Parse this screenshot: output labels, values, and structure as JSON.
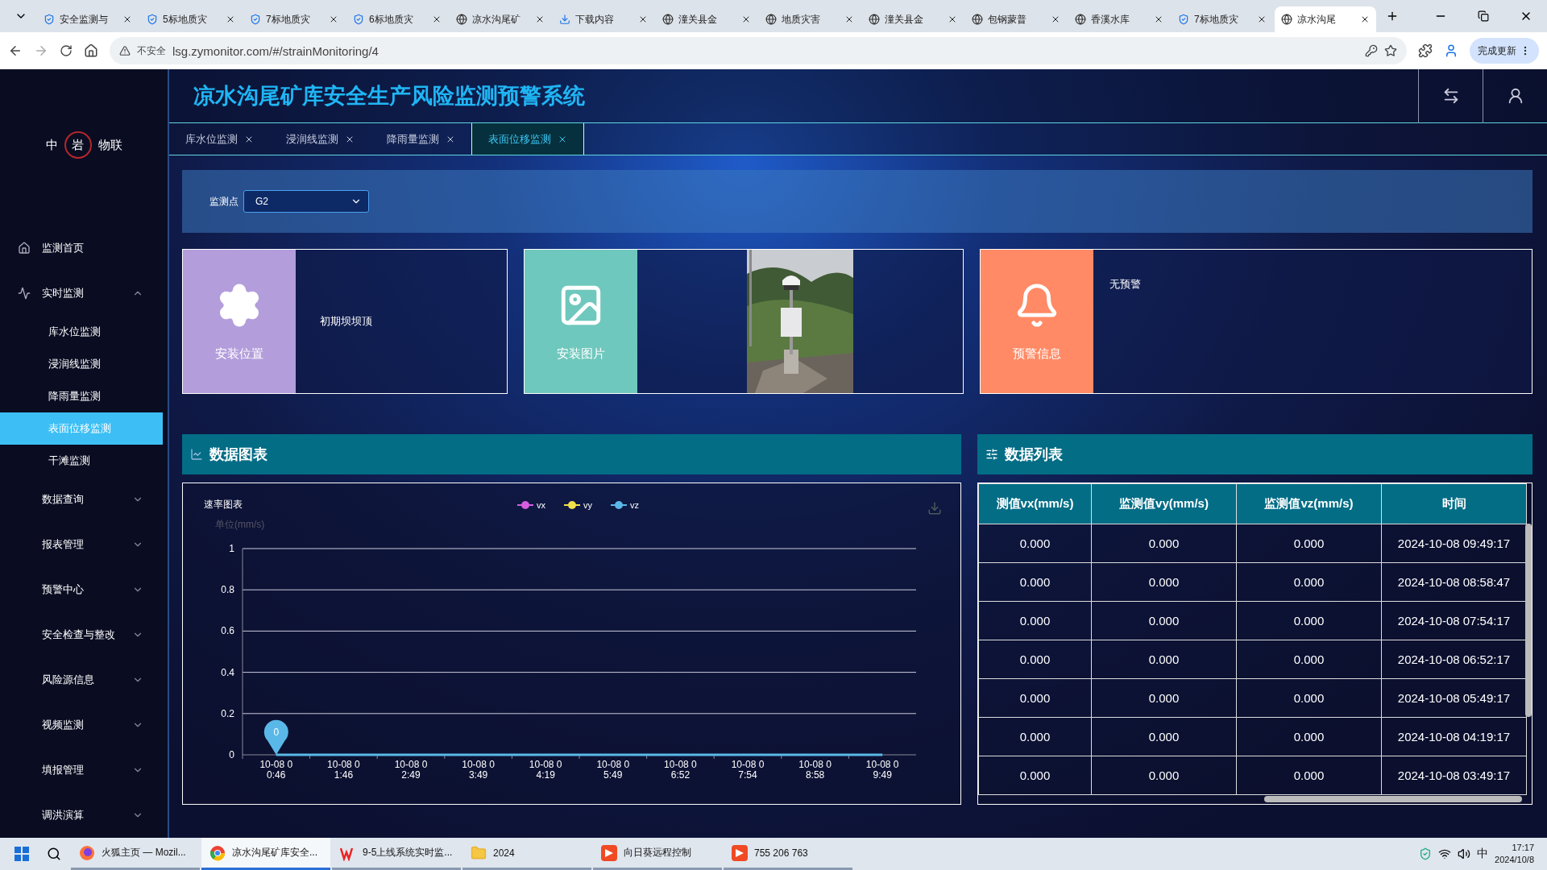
{
  "browser": {
    "tabs": [
      {
        "label": "安全监测与",
        "kind": "app",
        "selected": false
      },
      {
        "label": "5标地质灾",
        "kind": "app",
        "selected": false
      },
      {
        "label": "7标地质灾",
        "kind": "app",
        "selected": false
      },
      {
        "label": "6标地质灾",
        "kind": "app",
        "selected": false
      },
      {
        "label": "凉水沟尾矿",
        "kind": "globe",
        "selected": false
      },
      {
        "label": "下载内容",
        "kind": "download",
        "selected": false
      },
      {
        "label": "潼关县金",
        "kind": "globe",
        "selected": false
      },
      {
        "label": "地质灾害",
        "kind": "globe",
        "selected": false
      },
      {
        "label": "潼关县金",
        "kind": "globe",
        "selected": false
      },
      {
        "label": "包钢蒙普",
        "kind": "globe",
        "selected": false
      },
      {
        "label": "香溪水库",
        "kind": "globe",
        "selected": false
      },
      {
        "label": "7标地质灾",
        "kind": "app",
        "selected": false
      },
      {
        "label": "凉水沟尾",
        "kind": "globe",
        "selected": true
      }
    ],
    "security": "不安全",
    "url": "lsg.zymonitor.com/#/strainMonitoring/4",
    "update_button": "完成更新"
  },
  "app": {
    "logo": {
      "left": "中",
      "center": "岩",
      "right": "物联"
    },
    "title": "凉水沟尾矿库安全生产风险监测预警系统",
    "nav": [
      {
        "label": "监测首页",
        "kind": "link",
        "selected": false
      },
      {
        "label": "实时监测",
        "kind": "group",
        "expanded": true,
        "selected": false,
        "children": [
          {
            "label": "库水位监测",
            "selected": false
          },
          {
            "label": "浸润线监测",
            "selected": false
          },
          {
            "label": "降雨量监测",
            "selected": false
          },
          {
            "label": "表面位移监测",
            "selected": true
          },
          {
            "label": "干滩监测",
            "selected": false
          }
        ]
      },
      {
        "label": "数据查询",
        "kind": "group",
        "expanded": false,
        "selected": false
      },
      {
        "label": "报表管理",
        "kind": "group",
        "expanded": false,
        "selected": false
      },
      {
        "label": "预警中心",
        "kind": "group",
        "expanded": false,
        "selected": false
      },
      {
        "label": "安全检查与整改",
        "kind": "group",
        "expanded": false,
        "selected": false
      },
      {
        "label": "风险源信息",
        "kind": "group",
        "expanded": false,
        "selected": false
      },
      {
        "label": "视频监测",
        "kind": "group",
        "expanded": false,
        "selected": false
      },
      {
        "label": "填报管理",
        "kind": "group",
        "expanded": false,
        "selected": false
      },
      {
        "label": "调洪演算",
        "kind": "group",
        "expanded": false,
        "selected": false
      }
    ],
    "tabs": [
      {
        "label": "库水位监测",
        "selected": false
      },
      {
        "label": "浸润线监测",
        "selected": false
      },
      {
        "label": "降雨量监测",
        "selected": false
      },
      {
        "label": "表面位移监测",
        "selected": true
      }
    ],
    "filter": {
      "label": "监测点",
      "value": "G2"
    },
    "cards": [
      {
        "kind": "location",
        "label": "安装位置",
        "text": "初期坝坝顶",
        "color": "#b39ddb"
      },
      {
        "label": "安装图片",
        "color": "#6fc8bd"
      },
      {
        "kind": "alert",
        "label": "预警信息",
        "text": "无预警",
        "color": "#ff8a65"
      }
    ],
    "chart_panel": {
      "title": "数据图表",
      "chart_data": {
        "type": "line",
        "title": "速率图表",
        "ylabel": "单位(mm/s)",
        "categories": [
          "10-08 00:46",
          "10-08 01:46",
          "10-08 02:49",
          "10-08 03:49",
          "10-08 04:19",
          "10-08 05:49",
          "10-08 06:52",
          "10-08 07:54",
          "10-08 08:58",
          "10-08 09:49"
        ],
        "series": [
          {
            "name": "vx",
            "color": "#d65ce0",
            "values": [
              null,
              null,
              null,
              null,
              null,
              null,
              null,
              null,
              null,
              null
            ]
          },
          {
            "name": "vy",
            "color": "#f0e04a",
            "values": [
              null,
              null,
              null,
              null,
              null,
              null,
              null,
              null,
              null,
              null
            ]
          },
          {
            "name": "vz",
            "color": "#5ab8e8",
            "values": [
              0,
              0,
              0,
              0,
              0,
              0,
              0,
              0,
              0,
              0
            ]
          }
        ],
        "ylim": [
          0,
          1
        ],
        "yticks": [
          0,
          0.2,
          0.4,
          0.6,
          0.8,
          1
        ],
        "grid": true,
        "legend": "top",
        "annotations": [
          {
            "x": "10-08 00:46",
            "y": 0,
            "text": "0"
          }
        ]
      }
    },
    "table_panel": {
      "title": "数据列表",
      "columns": [
        "测值vx(mm/s)",
        "监测值vy(mm/s)",
        "监测值vz(mm/s)",
        "时间"
      ],
      "rows": [
        [
          "0.000",
          "0.000",
          "0.000",
          "2024-10-08 09:49:17"
        ],
        [
          "0.000",
          "0.000",
          "0.000",
          "2024-10-08 08:58:47"
        ],
        [
          "0.000",
          "0.000",
          "0.000",
          "2024-10-08 07:54:17"
        ],
        [
          "0.000",
          "0.000",
          "0.000",
          "2024-10-08 06:52:17"
        ],
        [
          "0.000",
          "0.000",
          "0.000",
          "2024-10-08 05:49:17"
        ],
        [
          "0.000",
          "0.000",
          "0.000",
          "2024-10-08 04:19:17"
        ],
        [
          "0.000",
          "0.000",
          "0.000",
          "2024-10-08 03:49:17"
        ]
      ]
    }
  },
  "taskbar": {
    "apps": [
      {
        "label": "火狐主页 — Mozil...",
        "kind": "firefox",
        "selected": false
      },
      {
        "label": "凉水沟尾矿库安全...",
        "kind": "chrome",
        "selected": true
      },
      {
        "label": "9-5上线系统实时监...",
        "kind": "wps",
        "selected": false
      },
      {
        "label": "2024",
        "kind": "folder",
        "selected": false
      },
      {
        "label": "向日葵远程控制",
        "kind": "sunlogin",
        "selected": false
      },
      {
        "label": "755 206 763",
        "kind": "sunlogin",
        "selected": false
      }
    ],
    "ime": "中",
    "time": "17:17",
    "date": "2024/10/8"
  }
}
